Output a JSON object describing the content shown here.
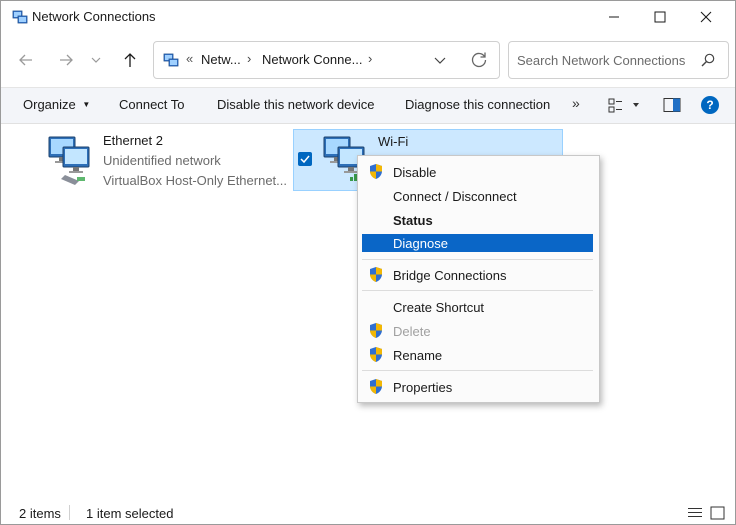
{
  "window": {
    "title": "Network Connections"
  },
  "address_bar": {
    "overflow": "«",
    "crumbs": [
      "Netw...",
      "Network Conne..."
    ],
    "search_placeholder": "Search Network Connections"
  },
  "command_bar": {
    "organize": "Organize",
    "connect_to": "Connect To",
    "disable_device": "Disable this network device",
    "diagnose_connection": "Diagnose this connection",
    "more": "»"
  },
  "items": [
    {
      "name": "Ethernet 2",
      "status": "Unidentified network",
      "device": "VirtualBox Host-Only Ethernet...",
      "selected": false
    },
    {
      "name": "Wi-Fi",
      "selected": true
    }
  ],
  "context_menu": {
    "items": [
      {
        "label": "Disable",
        "shield": true
      },
      {
        "label": "Connect / Disconnect",
        "shield": false
      },
      {
        "label": "Status",
        "shield": false,
        "bold": true
      },
      {
        "label": "Diagnose",
        "shield": false,
        "highlighted": true
      },
      {
        "label": "Bridge Connections",
        "shield": true
      },
      {
        "label": "Create Shortcut",
        "shield": false
      },
      {
        "label": "Delete",
        "shield": true,
        "disabled": true
      },
      {
        "label": "Rename",
        "shield": true
      },
      {
        "label": "Properties",
        "shield": true
      }
    ]
  },
  "status_bar": {
    "item_count": "2 items",
    "selection": "1 item selected"
  },
  "colors": {
    "accent": "#0067c0",
    "selection_bg": "#cce8ff",
    "menu_highlight": "#0a66c7",
    "command_bar_bg": "#f3f5f9"
  },
  "icons": [
    "network-connections-icon",
    "minimize-icon",
    "maximize-icon",
    "close-icon",
    "back-arrow-icon",
    "forward-arrow-icon",
    "chevron-down-icon",
    "up-arrow-icon",
    "refresh-icon",
    "search-icon",
    "view-options-icon",
    "preview-pane-icon",
    "help-icon",
    "network-adapter-icon",
    "uac-shield-icon",
    "details-view-icon",
    "tiles-view-icon"
  ]
}
